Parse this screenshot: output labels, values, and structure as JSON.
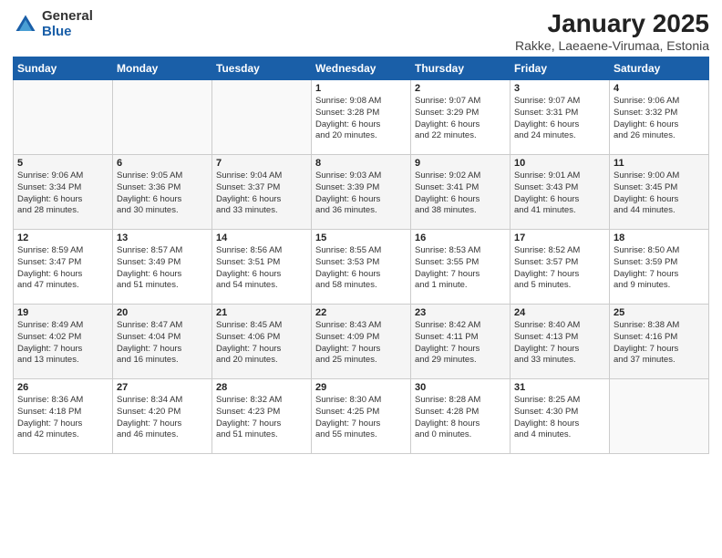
{
  "logo": {
    "general": "General",
    "blue": "Blue"
  },
  "title": "January 2025",
  "subtitle": "Rakke, Laeaene-Virumaa, Estonia",
  "weekdays": [
    "Sunday",
    "Monday",
    "Tuesday",
    "Wednesday",
    "Thursday",
    "Friday",
    "Saturday"
  ],
  "weeks": [
    [
      {
        "day": "",
        "info": ""
      },
      {
        "day": "",
        "info": ""
      },
      {
        "day": "",
        "info": ""
      },
      {
        "day": "1",
        "info": "Sunrise: 9:08 AM\nSunset: 3:28 PM\nDaylight: 6 hours\nand 20 minutes."
      },
      {
        "day": "2",
        "info": "Sunrise: 9:07 AM\nSunset: 3:29 PM\nDaylight: 6 hours\nand 22 minutes."
      },
      {
        "day": "3",
        "info": "Sunrise: 9:07 AM\nSunset: 3:31 PM\nDaylight: 6 hours\nand 24 minutes."
      },
      {
        "day": "4",
        "info": "Sunrise: 9:06 AM\nSunset: 3:32 PM\nDaylight: 6 hours\nand 26 minutes."
      }
    ],
    [
      {
        "day": "5",
        "info": "Sunrise: 9:06 AM\nSunset: 3:34 PM\nDaylight: 6 hours\nand 28 minutes."
      },
      {
        "day": "6",
        "info": "Sunrise: 9:05 AM\nSunset: 3:36 PM\nDaylight: 6 hours\nand 30 minutes."
      },
      {
        "day": "7",
        "info": "Sunrise: 9:04 AM\nSunset: 3:37 PM\nDaylight: 6 hours\nand 33 minutes."
      },
      {
        "day": "8",
        "info": "Sunrise: 9:03 AM\nSunset: 3:39 PM\nDaylight: 6 hours\nand 36 minutes."
      },
      {
        "day": "9",
        "info": "Sunrise: 9:02 AM\nSunset: 3:41 PM\nDaylight: 6 hours\nand 38 minutes."
      },
      {
        "day": "10",
        "info": "Sunrise: 9:01 AM\nSunset: 3:43 PM\nDaylight: 6 hours\nand 41 minutes."
      },
      {
        "day": "11",
        "info": "Sunrise: 9:00 AM\nSunset: 3:45 PM\nDaylight: 6 hours\nand 44 minutes."
      }
    ],
    [
      {
        "day": "12",
        "info": "Sunrise: 8:59 AM\nSunset: 3:47 PM\nDaylight: 6 hours\nand 47 minutes."
      },
      {
        "day": "13",
        "info": "Sunrise: 8:57 AM\nSunset: 3:49 PM\nDaylight: 6 hours\nand 51 minutes."
      },
      {
        "day": "14",
        "info": "Sunrise: 8:56 AM\nSunset: 3:51 PM\nDaylight: 6 hours\nand 54 minutes."
      },
      {
        "day": "15",
        "info": "Sunrise: 8:55 AM\nSunset: 3:53 PM\nDaylight: 6 hours\nand 58 minutes."
      },
      {
        "day": "16",
        "info": "Sunrise: 8:53 AM\nSunset: 3:55 PM\nDaylight: 7 hours\nand 1 minute."
      },
      {
        "day": "17",
        "info": "Sunrise: 8:52 AM\nSunset: 3:57 PM\nDaylight: 7 hours\nand 5 minutes."
      },
      {
        "day": "18",
        "info": "Sunrise: 8:50 AM\nSunset: 3:59 PM\nDaylight: 7 hours\nand 9 minutes."
      }
    ],
    [
      {
        "day": "19",
        "info": "Sunrise: 8:49 AM\nSunset: 4:02 PM\nDaylight: 7 hours\nand 13 minutes."
      },
      {
        "day": "20",
        "info": "Sunrise: 8:47 AM\nSunset: 4:04 PM\nDaylight: 7 hours\nand 16 minutes."
      },
      {
        "day": "21",
        "info": "Sunrise: 8:45 AM\nSunset: 4:06 PM\nDaylight: 7 hours\nand 20 minutes."
      },
      {
        "day": "22",
        "info": "Sunrise: 8:43 AM\nSunset: 4:09 PM\nDaylight: 7 hours\nand 25 minutes."
      },
      {
        "day": "23",
        "info": "Sunrise: 8:42 AM\nSunset: 4:11 PM\nDaylight: 7 hours\nand 29 minutes."
      },
      {
        "day": "24",
        "info": "Sunrise: 8:40 AM\nSunset: 4:13 PM\nDaylight: 7 hours\nand 33 minutes."
      },
      {
        "day": "25",
        "info": "Sunrise: 8:38 AM\nSunset: 4:16 PM\nDaylight: 7 hours\nand 37 minutes."
      }
    ],
    [
      {
        "day": "26",
        "info": "Sunrise: 8:36 AM\nSunset: 4:18 PM\nDaylight: 7 hours\nand 42 minutes."
      },
      {
        "day": "27",
        "info": "Sunrise: 8:34 AM\nSunset: 4:20 PM\nDaylight: 7 hours\nand 46 minutes."
      },
      {
        "day": "28",
        "info": "Sunrise: 8:32 AM\nSunset: 4:23 PM\nDaylight: 7 hours\nand 51 minutes."
      },
      {
        "day": "29",
        "info": "Sunrise: 8:30 AM\nSunset: 4:25 PM\nDaylight: 7 hours\nand 55 minutes."
      },
      {
        "day": "30",
        "info": "Sunrise: 8:28 AM\nSunset: 4:28 PM\nDaylight: 8 hours\nand 0 minutes."
      },
      {
        "day": "31",
        "info": "Sunrise: 8:25 AM\nSunset: 4:30 PM\nDaylight: 8 hours\nand 4 minutes."
      },
      {
        "day": "",
        "info": ""
      }
    ]
  ]
}
